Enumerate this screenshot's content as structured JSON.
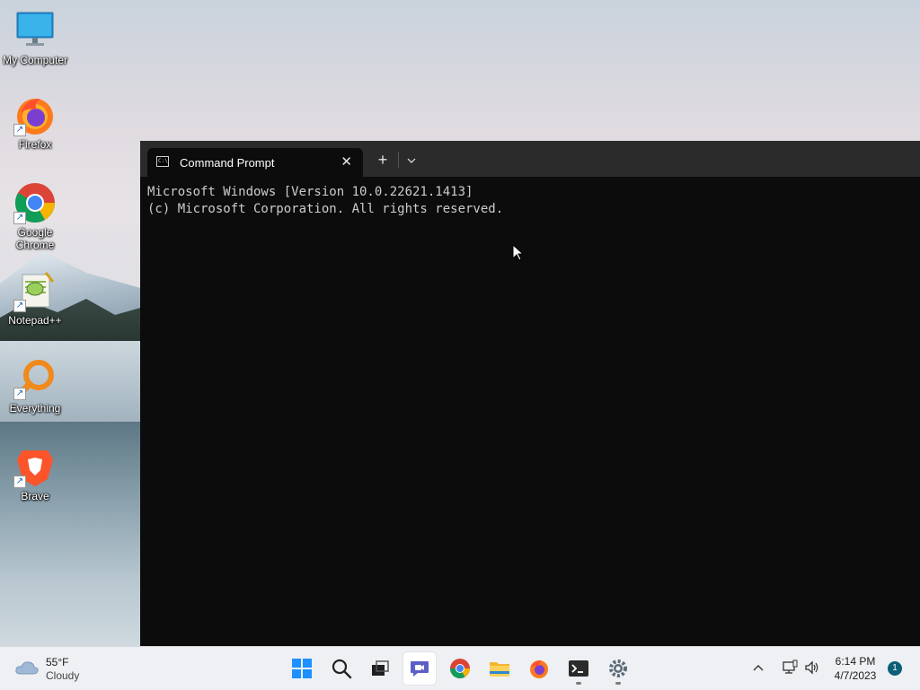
{
  "desktop": {
    "icons": [
      {
        "label": "My Computer",
        "icon": "monitor-icon",
        "shortcut": false
      },
      {
        "label": "Firefox",
        "icon": "firefox-icon",
        "shortcut": true
      },
      {
        "label": "Google Chrome",
        "icon": "chrome-icon",
        "shortcut": true
      },
      {
        "label": "Notepad++",
        "icon": "notepadpp-icon",
        "shortcut": true
      },
      {
        "label": "Everything",
        "icon": "everything-search-icon",
        "shortcut": true
      },
      {
        "label": "Brave",
        "icon": "brave-icon",
        "shortcut": true
      }
    ]
  },
  "terminal": {
    "tab_title": "Command Prompt",
    "new_tab": "+",
    "dropdown": "⌄",
    "close": "✕",
    "lines": [
      "Microsoft Windows [Version 10.0.22621.1413]",
      "(c) Microsoft Corporation. All rights reserved."
    ]
  },
  "taskbar": {
    "weather": {
      "temp": "55°F",
      "condition": "Cloudy"
    },
    "apps": [
      "start-icon",
      "search-icon",
      "task-view-icon",
      "teams-chat-icon",
      "chrome-icon",
      "file-explorer-icon",
      "firefox-icon",
      "terminal-icon",
      "settings-icon"
    ],
    "clock": {
      "time": "6:14 PM",
      "date": "4/7/2023"
    },
    "notification_count": "1",
    "tray_chevron": "^"
  },
  "colors": {
    "terminal_bg": "#0c0c0c",
    "titlebar_bg": "#2b2b2b",
    "text": "#cccccc",
    "taskbar_bg": "#eef0f3",
    "accent": "#0b5f78"
  }
}
